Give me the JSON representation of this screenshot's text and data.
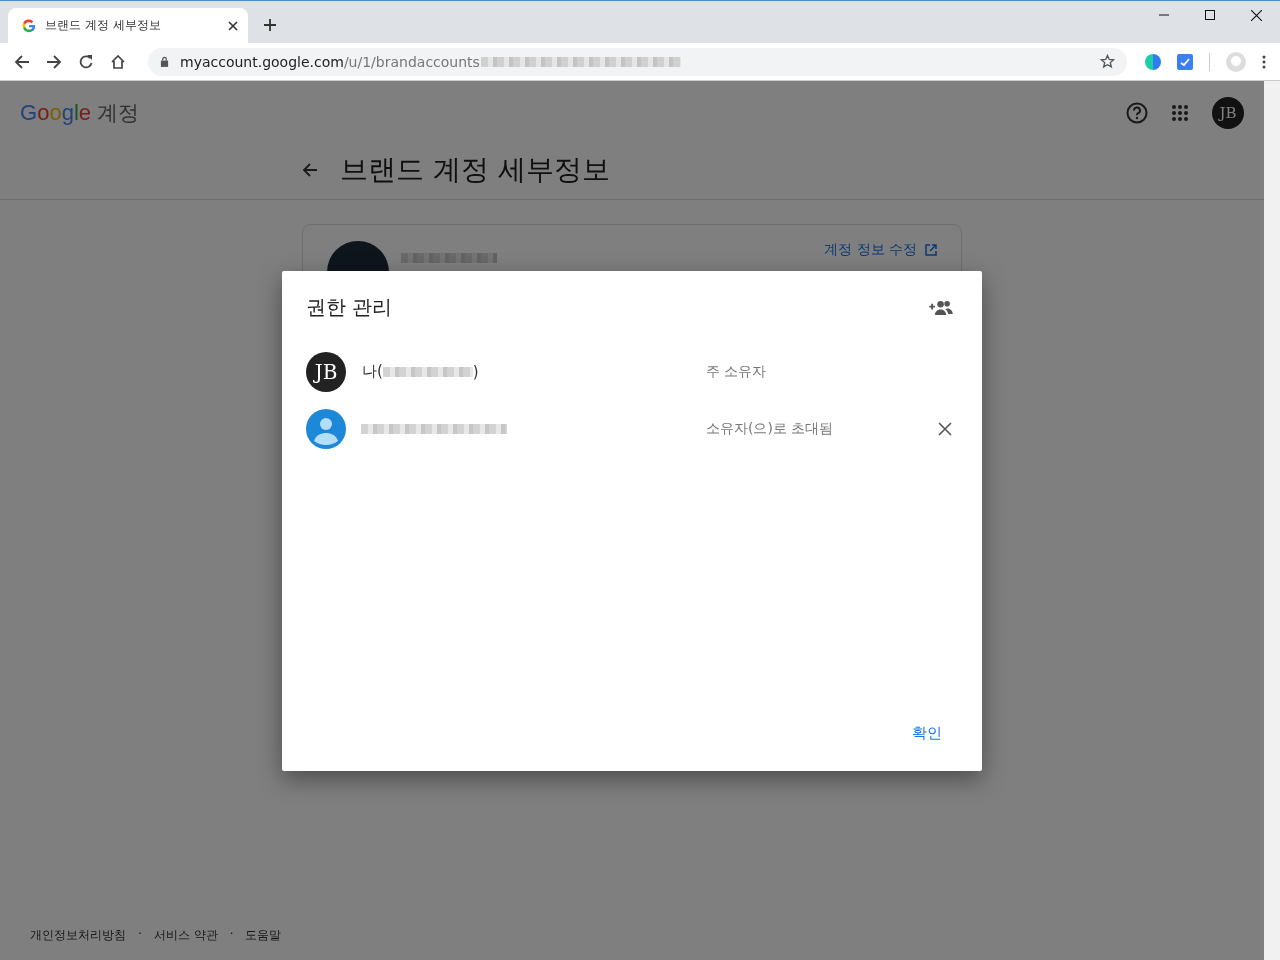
{
  "browser": {
    "tab": {
      "title": "브랜드 계정 세부정보"
    },
    "url": {
      "host": "myaccount.google.com",
      "path": "/u/1/brandaccounts"
    }
  },
  "header": {
    "logo": "Google",
    "product": "계정",
    "avatar": "JB"
  },
  "page_title": "브랜드 계정 세부정보",
  "card": {
    "edit_link": "계정 정보 수정"
  },
  "dialog": {
    "title": "권한 관리",
    "members": [
      {
        "kind": "self",
        "avatar": "JB",
        "name_prefix": "나(",
        "name_suffix": ")",
        "role": "주 소유자"
      },
      {
        "kind": "invited",
        "role": "소유자(으)로 초대됨"
      }
    ],
    "confirm": "확인"
  },
  "footer": {
    "links": [
      "개인정보처리방침",
      "서비스 약관",
      "도움말"
    ],
    "separator": "·"
  }
}
